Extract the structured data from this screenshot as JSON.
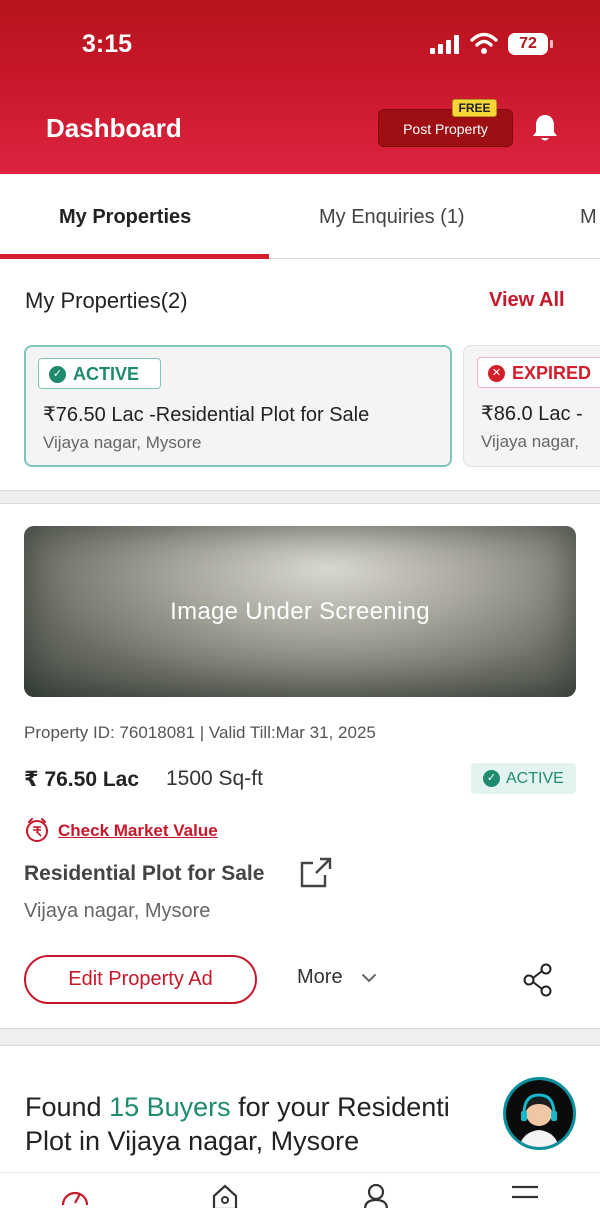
{
  "status_bar": {
    "time": "3:15",
    "battery": "72"
  },
  "header": {
    "title": "Dashboard",
    "post_property_label": "Post Property",
    "free_badge": "FREE"
  },
  "tabs": [
    {
      "label": "My Properties",
      "active": true
    },
    {
      "label": "My Enquiries (1)",
      "active": false
    },
    {
      "label": "M",
      "active": false
    }
  ],
  "my_properties": {
    "title": "My Properties(2)",
    "view_all": "View All",
    "cards": [
      {
        "status": "ACTIVE",
        "price_title": "₹76.50 Lac -Residential Plot for Sale",
        "location": "Vijaya nagar, Mysore"
      },
      {
        "status": "EXPIRED",
        "price_title": "₹86.0 Lac -",
        "location": "Vijaya nagar,"
      }
    ]
  },
  "property": {
    "image_text": "Image Under Screening",
    "meta": "Property ID: 76018081  |  Valid Till:Mar 31, 2025",
    "price": "₹ 76.50 Lac",
    "area": "1500 Sq-ft",
    "status": "ACTIVE",
    "check_market_value": "Check Market Value",
    "title": "Residential Plot for Sale",
    "location": "Vijaya nagar, Mysore",
    "edit_button": "Edit Property Ad",
    "more_label": "More"
  },
  "buyers": {
    "prefix": "Found ",
    "highlight": "15 Buyers",
    "suffix": " for your Residenti",
    "line2": "Plot  in Vijaya nagar, Mysore"
  },
  "colors": {
    "brand_red": "#c8172a",
    "active_green": "#1e8b6f",
    "expired_red": "#d21f2b"
  },
  "icons": [
    "signal-icon",
    "wifi-icon",
    "battery-icon",
    "bell-icon",
    "check-circle-icon",
    "close-circle-icon",
    "rupee-tag-icon",
    "external-link-icon",
    "chevron-down-icon",
    "share-icon",
    "support-agent-icon",
    "dashboard-gauge-icon",
    "home-icon",
    "user-icon",
    "menu-icon"
  ]
}
